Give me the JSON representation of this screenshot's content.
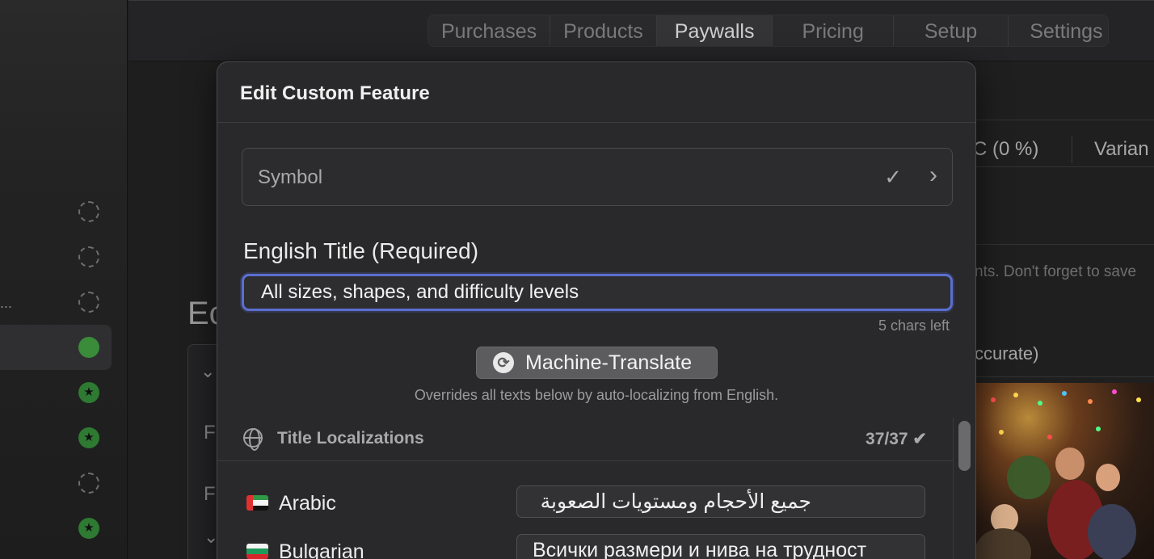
{
  "topbar": {
    "tabs": [
      {
        "label": "Purchases",
        "active": false
      },
      {
        "label": "Products",
        "active": false
      },
      {
        "label": "Paywalls",
        "active": true
      },
      {
        "label": "Pricing",
        "active": false
      },
      {
        "label": "Setup",
        "active": false
      },
      {
        "label": "Settings",
        "active": false
      }
    ]
  },
  "sidebar": {
    "status_icons": [
      "empty",
      "empty",
      "empty",
      "full",
      "star",
      "star",
      "empty",
      "star"
    ],
    "ellipsis": "..."
  },
  "background": {
    "title_fragment": "Ec",
    "f1": "F",
    "f2": "F",
    "right_header": "C (0 %)",
    "right_header2": "Varian",
    "right_hint": "nts. Don't forget to save",
    "right_note": "ccurate)"
  },
  "modal": {
    "title": "Edit Custom Feature",
    "symbol_label": "Symbol",
    "english_title_label": "English Title (Required)",
    "english_title_value": "All sizes, shapes, and difficulty levels",
    "chars_left": "5 chars left",
    "machine_translate_label": "Machine-Translate",
    "machine_translate_sub": "Overrides all texts below by auto-localizing from English.",
    "localizations_title": "Title Localizations",
    "localizations_count": "37/37 ✔",
    "languages": [
      {
        "name": "Arabic",
        "value": "جميع الأحجام ومستويات الصعوبة"
      },
      {
        "name": "Bulgarian",
        "value": "Всички размери и нива на трудност"
      }
    ]
  },
  "colors": {
    "accent_focus": "#5a6fd0",
    "sidebar_green": "#3a8b3a"
  }
}
